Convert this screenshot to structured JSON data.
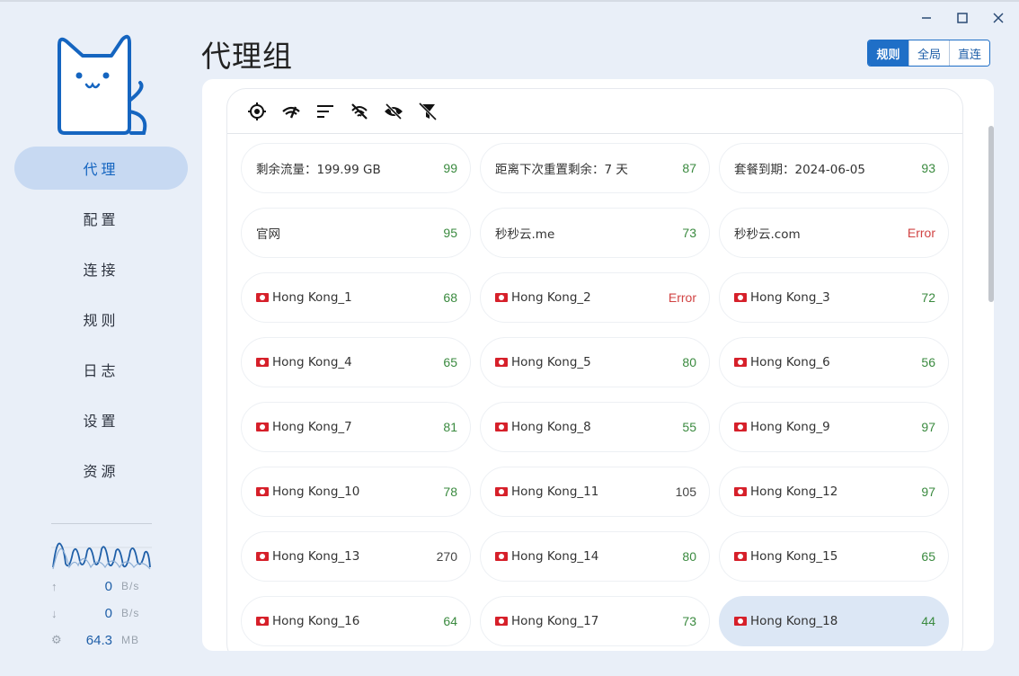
{
  "window": {
    "minimize_icon": "minimize-icon",
    "maximize_icon": "maximize-icon",
    "close_icon": "close-icon"
  },
  "sidebar": {
    "items": [
      {
        "label": "代理",
        "active": true
      },
      {
        "label": "配置",
        "active": false
      },
      {
        "label": "连接",
        "active": false
      },
      {
        "label": "规则",
        "active": false
      },
      {
        "label": "日志",
        "active": false
      },
      {
        "label": "设置",
        "active": false
      },
      {
        "label": "资源",
        "active": false
      }
    ],
    "traffic": {
      "upload": {
        "value": "0",
        "unit": "B/s"
      },
      "download": {
        "value": "0",
        "unit": "B/s"
      },
      "memory": {
        "value": "64.3",
        "unit": "MB"
      }
    }
  },
  "header": {
    "title": "代理组",
    "modes": [
      {
        "label": "规则",
        "active": true
      },
      {
        "label": "全局",
        "active": false
      },
      {
        "label": "直连",
        "active": false
      }
    ]
  },
  "toolbar": {
    "icons": [
      "locate-icon",
      "network-speed-icon",
      "sort-icon",
      "wifi-off-icon",
      "eye-off-icon",
      "filter-off-icon"
    ]
  },
  "proxies": [
    {
      "name": "剩余流量：199.99 GB",
      "delay": "99",
      "flag": false,
      "status": "ok"
    },
    {
      "name": "距离下次重置剩余：7 天",
      "delay": "87",
      "flag": false,
      "status": "ok"
    },
    {
      "name": "套餐到期：2024-06-05",
      "delay": "93",
      "flag": false,
      "status": "ok"
    },
    {
      "name": "官网",
      "delay": "95",
      "flag": false,
      "status": "ok"
    },
    {
      "name": "秒秒云.me",
      "delay": "73",
      "flag": false,
      "status": "ok"
    },
    {
      "name": "秒秒云.com",
      "delay": "Error",
      "flag": false,
      "status": "error"
    },
    {
      "name": "Hong Kong_1",
      "delay": "68",
      "flag": true,
      "status": "ok"
    },
    {
      "name": "Hong Kong_2",
      "delay": "Error",
      "flag": true,
      "status": "error"
    },
    {
      "name": "Hong Kong_3",
      "delay": "72",
      "flag": true,
      "status": "ok"
    },
    {
      "name": "Hong Kong_4",
      "delay": "65",
      "flag": true,
      "status": "ok"
    },
    {
      "name": "Hong Kong_5",
      "delay": "80",
      "flag": true,
      "status": "ok"
    },
    {
      "name": "Hong Kong_6",
      "delay": "56",
      "flag": true,
      "status": "ok"
    },
    {
      "name": "Hong Kong_7",
      "delay": "81",
      "flag": true,
      "status": "ok"
    },
    {
      "name": "Hong Kong_8",
      "delay": "55",
      "flag": true,
      "status": "ok"
    },
    {
      "name": "Hong Kong_9",
      "delay": "97",
      "flag": true,
      "status": "ok"
    },
    {
      "name": "Hong Kong_10",
      "delay": "78",
      "flag": true,
      "status": "ok"
    },
    {
      "name": "Hong Kong_11",
      "delay": "105",
      "flag": true,
      "status": "slow"
    },
    {
      "name": "Hong Kong_12",
      "delay": "97",
      "flag": true,
      "status": "ok"
    },
    {
      "name": "Hong Kong_13",
      "delay": "270",
      "flag": true,
      "status": "slow"
    },
    {
      "name": "Hong Kong_14",
      "delay": "80",
      "flag": true,
      "status": "ok"
    },
    {
      "name": "Hong Kong_15",
      "delay": "65",
      "flag": true,
      "status": "ok"
    },
    {
      "name": "Hong Kong_16",
      "delay": "64",
      "flag": true,
      "status": "ok"
    },
    {
      "name": "Hong Kong_17",
      "delay": "73",
      "flag": true,
      "status": "ok"
    },
    {
      "name": "Hong Kong_18",
      "delay": "44",
      "flag": true,
      "status": "ok",
      "selected": true
    }
  ],
  "colors": {
    "accent": "#1f6fc7",
    "ok": "#3a8a3f",
    "error": "#d14343",
    "nav_active_bg": "#c7d9f2"
  }
}
